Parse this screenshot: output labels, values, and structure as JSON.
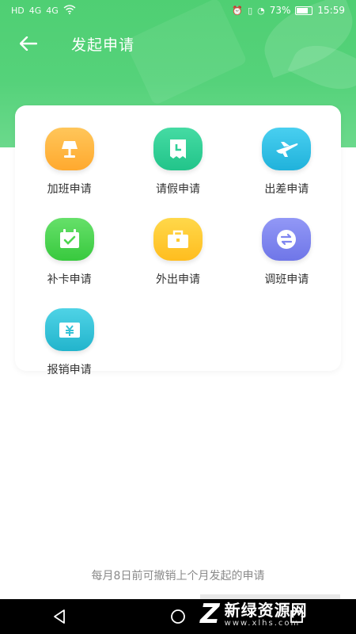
{
  "status_bar": {
    "left_icons": [
      "HD",
      "4G",
      "4G",
      "wifi"
    ],
    "battery": "73%",
    "time": "15:59"
  },
  "header": {
    "title": "发起申请",
    "back_icon": "arrow-left-icon"
  },
  "colors": {
    "header_green": "#4fcf73",
    "orange": "#ffb23e",
    "teal": "#2ecf96",
    "sky": "#31c1e6",
    "green": "#4ed64f",
    "yellow": "#ffcb2e",
    "purple": "#7f86f0",
    "cyan": "#35c2d6"
  },
  "tiles": [
    {
      "label": "加班申请",
      "icon": "lamp-icon"
    },
    {
      "label": "请假申请",
      "icon": "clock-document-icon"
    },
    {
      "label": "出差申请",
      "icon": "airplane-icon"
    },
    {
      "label": "补卡申请",
      "icon": "calendar-check-icon"
    },
    {
      "label": "外出申请",
      "icon": "briefcase-icon"
    },
    {
      "label": "调班申请",
      "icon": "swap-arrows-icon"
    },
    {
      "label": "报销申请",
      "icon": "yuan-wallet-icon"
    }
  ],
  "footer_note": "每月8日前可撤销上个月发起的申请",
  "watermark": {
    "logo": "Z",
    "cn": "新绿资源网",
    "en": "www.xlhs.com"
  }
}
